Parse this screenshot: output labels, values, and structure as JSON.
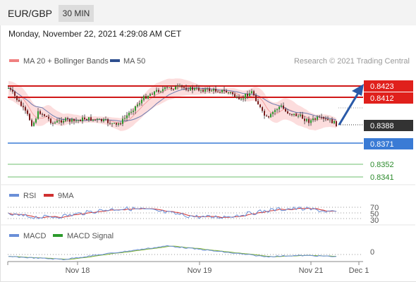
{
  "header": {
    "symbol": "EUR/GBP",
    "timeframe": "30 MIN"
  },
  "timestamp": "Monday, November 22, 2021 4:29:08 AM CET",
  "colors": {
    "red": "#e0201c",
    "blue": "#3a7bd5",
    "green": "#2b9a2b",
    "dark": "#333333",
    "band": "#f8c8c8",
    "ma50": "#4a5b9a",
    "macd": "#6a8fd8",
    "signal": "#7ab02a",
    "rsi": "#6a8fd8",
    "rsi9ma": "#d03030"
  },
  "chart_data": [
    {
      "type": "candlestick",
      "title": "",
      "legend": [
        {
          "name": "MA 20 + Bollinger Bands",
          "color": "#f08080"
        },
        {
          "name": "MA 50",
          "color": "#2e4f8f"
        }
      ],
      "legend_position": "top-left",
      "credit": "Research © 2021 Trading Central",
      "ylim": [
        0.8325,
        0.845
      ],
      "x_ticks": [
        "Nov 18",
        "Nov 19",
        "Nov 21",
        "Dec 1"
      ],
      "resistance_levels": [
        0.8423,
        0.8412
      ],
      "current_price": 0.8388,
      "pivot_level": 0.8371,
      "support_levels": [
        0.8352,
        0.8341
      ],
      "level_labels": [
        "0.8423",
        "0.8412",
        "0.8388",
        "0.8371",
        "0.8352",
        "0.8341"
      ],
      "arrow": {
        "from": 0.8388,
        "to": 0.8423,
        "direction": "up"
      }
    },
    {
      "type": "line",
      "title": "RSI",
      "legend": [
        {
          "name": "RSI",
          "color": "#6a8fd8"
        },
        {
          "name": "9MA",
          "color": "#d03030"
        }
      ],
      "levels": [
        70,
        50,
        30
      ],
      "level_labels": [
        "70",
        "50",
        "30"
      ]
    },
    {
      "type": "line",
      "title": "MACD",
      "legend": [
        {
          "name": "MACD",
          "color": "#6a8fd8"
        },
        {
          "name": "MACD Signal",
          "color": "#2b9a2b"
        }
      ],
      "zero_label": "0"
    }
  ]
}
